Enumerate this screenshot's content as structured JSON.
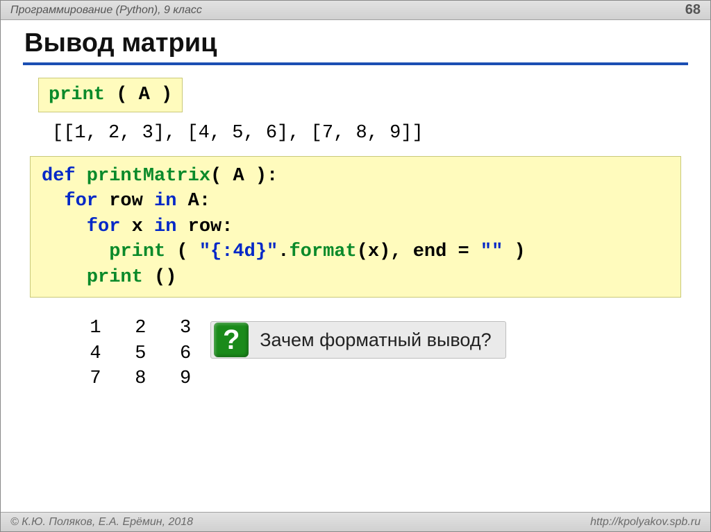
{
  "header": {
    "title": "Программирование (Python), 9 класс",
    "page_number": "68"
  },
  "slide": {
    "title": "Вывод матриц"
  },
  "code1": {
    "print_kw": "print",
    "args": " ( A )"
  },
  "output1": "[[1, 2, 3], [4, 5, 6], [7, 8, 9]]",
  "code2": {
    "line1_def": "def",
    "line1_name": " printMatrix",
    "line1_rest": "( A ):",
    "line2_for": "  for",
    "line2_rest": " row ",
    "line2_in": "in",
    "line2_end": " A:",
    "line3_for": "    for",
    "line3_rest": " x ",
    "line3_in": "in",
    "line3_end": " row:",
    "line4_pad": "      ",
    "line4_print": "print",
    "line4_mid": " ( ",
    "line4_str": "\"{:4d}\"",
    "line4_dot": ".",
    "line4_fmt": "format",
    "line4_args": "(x), end = ",
    "line4_empty": "\"\"",
    "line4_close": " )",
    "line5_pad": "    ",
    "line5_print": "print",
    "line5_rest": " ()"
  },
  "matrix_output": "  1   2   3\n  4   5   6\n  7   8   9",
  "callout": {
    "mark": "?",
    "text": "Зачем форматный вывод?"
  },
  "footer": {
    "left": "© К.Ю. Поляков, Е.А. Ерёмин, 2018",
    "right": "http://kpolyakov.spb.ru"
  }
}
